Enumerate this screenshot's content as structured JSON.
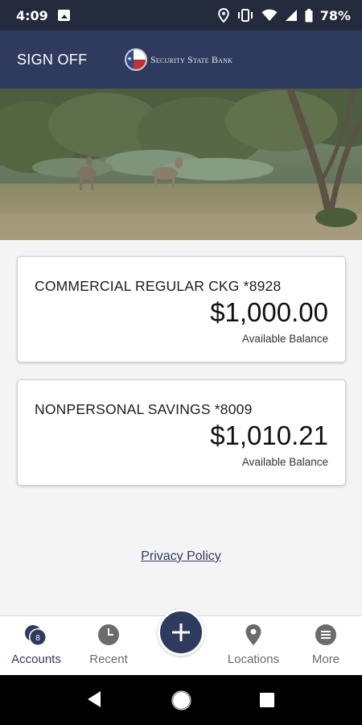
{
  "status_bar": {
    "time": "4:09",
    "battery": "78%",
    "icons": [
      "image-icon",
      "location-icon",
      "vibrate-icon",
      "wifi-icon",
      "signal-icon",
      "battery-icon"
    ]
  },
  "header": {
    "sign_off": "SIGN OFF",
    "bank_name": "Security State Bank"
  },
  "accounts": [
    {
      "name": "COMMERCIAL REGULAR CKG *8928",
      "balance": "$1,000.00",
      "balance_label": "Available Balance"
    },
    {
      "name": "NONPERSONAL SAVINGS *8009",
      "balance": "$1,010.21",
      "balance_label": "Available Balance"
    }
  ],
  "privacy_link": "Privacy Policy",
  "bottom_nav": {
    "accounts": {
      "label": "Accounts",
      "badge": "8"
    },
    "recent": {
      "label": "Recent"
    },
    "locations": {
      "label": "Locations"
    },
    "more": {
      "label": "More"
    }
  },
  "colors": {
    "status_bar": "#232a3b",
    "header": "#2f3b5e",
    "accent": "#2f3b5e",
    "background": "#f4f4f4"
  }
}
